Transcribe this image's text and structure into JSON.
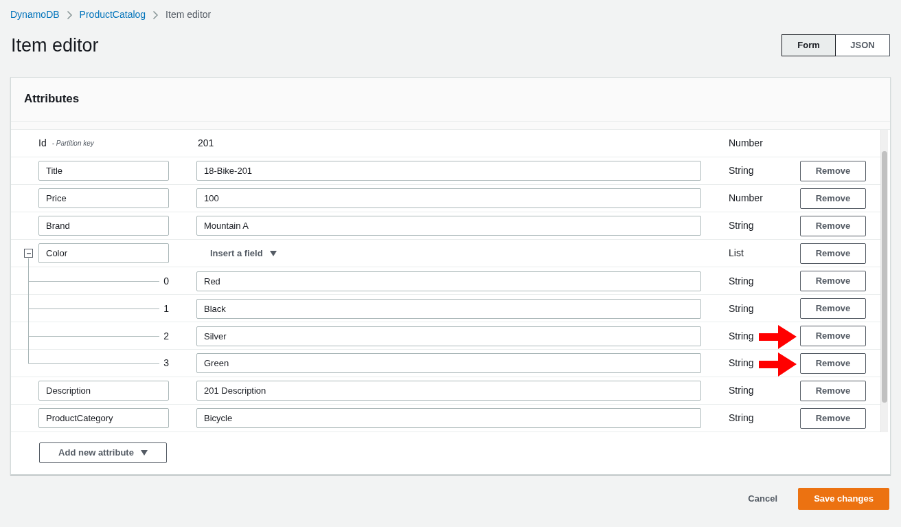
{
  "breadcrumb": [
    {
      "label": "DynamoDB",
      "link": true
    },
    {
      "label": "ProductCatalog",
      "link": true
    },
    {
      "label": "Item editor",
      "link": false
    }
  ],
  "title": "Item editor",
  "view_toggle": [
    {
      "label": "Form",
      "selected": true
    },
    {
      "label": "JSON",
      "selected": false
    }
  ],
  "panel": {
    "title": "Attributes",
    "attributes": [
      {
        "kind": "key",
        "name": "Id",
        "note": "- Partition key",
        "value": "201",
        "type": "Number"
      },
      {
        "kind": "field",
        "name": "Title",
        "value": "18-Bike-201",
        "type": "String",
        "action": "Remove"
      },
      {
        "kind": "field",
        "name": "Price",
        "value": "100",
        "type": "Number",
        "action": "Remove"
      },
      {
        "kind": "field",
        "name": "Brand",
        "value": "Mountain A",
        "type": "String",
        "action": "Remove"
      },
      {
        "kind": "list",
        "name": "Color",
        "expanded": true,
        "insert": "Insert a field",
        "type": "List",
        "action": "Remove",
        "children": [
          {
            "index": "0",
            "value": "Red",
            "type": "String",
            "action": "Remove",
            "arrow": false
          },
          {
            "index": "1",
            "value": "Black",
            "type": "String",
            "action": "Remove",
            "arrow": false
          },
          {
            "index": "2",
            "value": "Silver",
            "type": "String",
            "action": "Remove",
            "arrow": true
          },
          {
            "index": "3",
            "value": "Green",
            "type": "String",
            "action": "Remove",
            "arrow": true
          }
        ]
      },
      {
        "kind": "field",
        "name": "Description",
        "value": "201 Description",
        "type": "String",
        "action": "Remove"
      },
      {
        "kind": "field",
        "name": "ProductCategory",
        "value": "Bicycle",
        "type": "String",
        "action": "Remove"
      }
    ],
    "add_button": "Add new attribute"
  },
  "footer": {
    "cancel": "Cancel",
    "save": "Save changes"
  }
}
